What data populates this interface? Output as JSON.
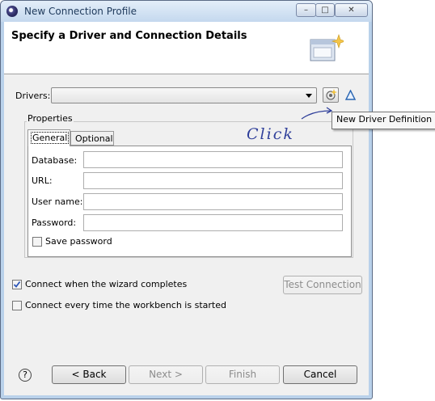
{
  "window": {
    "title": "New Connection Profile",
    "controls": {
      "minimize": "–",
      "maximize": "□",
      "close": "✕"
    }
  },
  "banner": {
    "title": "Specify a Driver and Connection Details"
  },
  "drivers": {
    "label": "Drivers:",
    "value": ""
  },
  "tooltip": "New Driver Definition",
  "annotation": "Click",
  "properties": {
    "label": "Properties",
    "tabs": [
      {
        "label": "General",
        "active": true
      },
      {
        "label": "Optional",
        "active": false
      }
    ],
    "fields": [
      {
        "label": "Database:",
        "value": ""
      },
      {
        "label": "URL:",
        "value": ""
      },
      {
        "label": "User name:",
        "value": ""
      },
      {
        "label": "Password:",
        "value": ""
      }
    ],
    "save_password": {
      "label": "Save password",
      "checked": false
    }
  },
  "options": {
    "connect_when_complete": {
      "label": "Connect when the wizard completes",
      "checked": true
    },
    "connect_every_time": {
      "label": "Connect every time the workbench is started",
      "checked": false
    }
  },
  "test_connection_label": "Test Connection",
  "footer": {
    "help": "?",
    "back": "< Back",
    "next": "Next >",
    "finish": "Finish",
    "cancel": "Cancel"
  },
  "colors": {
    "accent_check": "#2b55b8",
    "title_text": "#1e395b",
    "annotation_ink": "#2f3f9a"
  }
}
